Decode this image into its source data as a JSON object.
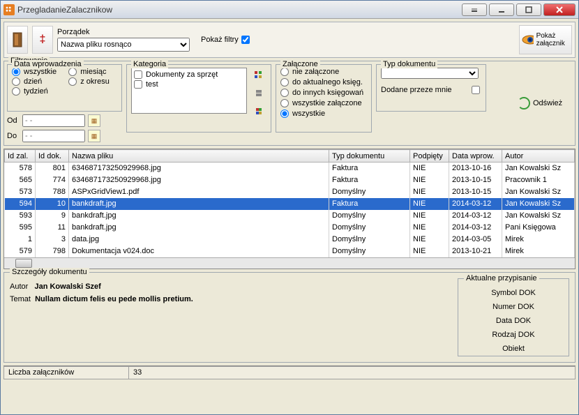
{
  "title": "PrzegladanieZalacznikow",
  "toolbar": {
    "order_label": "Porządek",
    "order_value": "Nazwa pliku rosnąco",
    "showfilters_label": "Pokaż filtry",
    "show_attachment": "Pokaż załącznik"
  },
  "filters": {
    "legend": "Filtrowanie",
    "date": {
      "legend": "Data wprowadzenia",
      "all": "wszystkie",
      "month": "miesiąc",
      "day": "dzień",
      "range": "z okresu",
      "week": "tydzień",
      "od": "Od",
      "do": "Do",
      "placeholder": "- -"
    },
    "category": {
      "legend": "Kategoria",
      "items": [
        "Dokumenty za sprzęt",
        "test"
      ]
    },
    "attached": {
      "legend": "Załączone",
      "opts": [
        "nie załączone",
        "do aktualnego księg.",
        "do innych księgowań",
        "wszystkie załączone",
        "wszystkie"
      ]
    },
    "doctype": {
      "legend": "Typ dokumentu",
      "addedbyme": "Dodane przeze mnie"
    },
    "refresh": "Odśwież"
  },
  "columns": [
    "Id zal.",
    "Id dok.",
    "Nazwa pliku",
    "Typ dokumentu",
    "Podpięty",
    "Data wprow.",
    "Autor"
  ],
  "rows": [
    {
      "idz": "578",
      "idd": "801",
      "name": "634687173250929968.jpg",
      "type": "Faktura",
      "att": "NIE",
      "date": "2013-10-16",
      "author": "Jan Kowalski Sz"
    },
    {
      "idz": "565",
      "idd": "774",
      "name": "634687173250929968.jpg",
      "type": "Faktura",
      "att": "NIE",
      "date": "2013-10-15",
      "author": "Pracownik 1"
    },
    {
      "idz": "573",
      "idd": "788",
      "name": "ASPxGridView1.pdf",
      "type": "Domyślny",
      "att": "NIE",
      "date": "2013-10-15",
      "author": "Jan Kowalski Sz"
    },
    {
      "idz": "594",
      "idd": "10",
      "name": "bankdraft.jpg",
      "type": "Faktura",
      "att": "NIE",
      "date": "2014-03-12",
      "author": "Jan Kowalski Sz",
      "sel": true
    },
    {
      "idz": "593",
      "idd": "9",
      "name": "bankdraft.jpg",
      "type": "Domyślny",
      "att": "NIE",
      "date": "2014-03-12",
      "author": "Jan Kowalski Sz"
    },
    {
      "idz": "595",
      "idd": "11",
      "name": "bankdraft.jpg",
      "type": "Domyślny",
      "att": "NIE",
      "date": "2014-03-12",
      "author": "Pani Księgowa"
    },
    {
      "idz": "1",
      "idd": "3",
      "name": "data.jpg",
      "type": "Domyślny",
      "att": "NIE",
      "date": "2014-03-05",
      "author": "Mirek"
    },
    {
      "idz": "579",
      "idd": "798",
      "name": "Dokumentacja v024.doc",
      "type": "Domyślny",
      "att": "NIE",
      "date": "2013-10-21",
      "author": "Mirek"
    }
  ],
  "details": {
    "legend": "Szczegóły dokumentu",
    "author_label": "Autor",
    "author": "Jan Kowalski Szef",
    "subject_label": "Temat",
    "subject": "Nullam dictum felis eu pede mollis pretium.",
    "assign": {
      "legend": "Aktualne przypisanie",
      "items": [
        "Symbol DOK",
        "Numer DOK",
        "Data DOK",
        "Rodzaj DOK",
        "Obiekt"
      ]
    }
  },
  "status": {
    "label": "Liczba załączników",
    "value": "33"
  }
}
